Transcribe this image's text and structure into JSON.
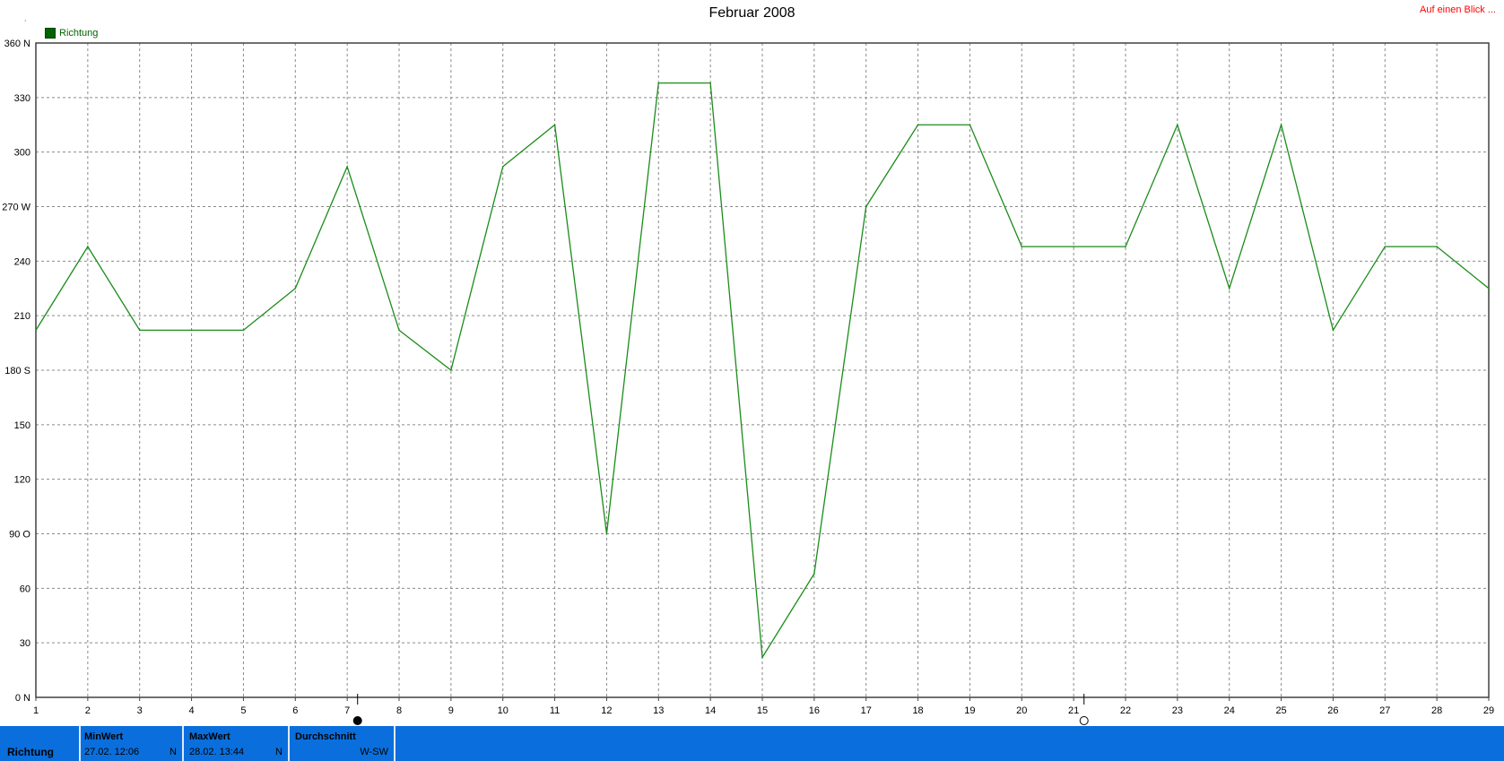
{
  "header": {
    "title": "Februar 2008",
    "link": "Auf einen Blick ...",
    "dot": "˙"
  },
  "legend": {
    "label": "Richtung",
    "color": "#006400"
  },
  "chart_data": {
    "type": "line",
    "title": "Februar 2008",
    "x": [
      1,
      2,
      3,
      4,
      5,
      6,
      7,
      8,
      9,
      10,
      11,
      12,
      13,
      14,
      15,
      16,
      17,
      18,
      19,
      20,
      21,
      22,
      23,
      24,
      25,
      26,
      27,
      28,
      29
    ],
    "series": [
      {
        "name": "Richtung",
        "values": [
          202,
          248,
          202,
          202,
          202,
          225,
          292,
          202,
          180,
          292,
          315,
          90,
          338,
          338,
          22,
          68,
          270,
          315,
          315,
          248,
          248,
          248,
          315,
          225,
          315,
          202,
          248,
          248,
          225
        ]
      }
    ],
    "ylim": [
      0,
      360
    ],
    "yticks": [
      0,
      30,
      60,
      90,
      120,
      150,
      180,
      210,
      240,
      270,
      300,
      330,
      360
    ],
    "ytick_labels": [
      "0",
      "30",
      "60",
      "90",
      "120",
      "150",
      "180",
      "210",
      "240",
      "270",
      "300",
      "330",
      "360"
    ],
    "ytick_directions": {
      "0": "N",
      "90": "O",
      "180": "S",
      "270": "W",
      "360": "N"
    },
    "xticks": [
      "1",
      "2",
      "3",
      "4",
      "5",
      "6",
      "7",
      "8",
      "9",
      "10",
      "11",
      "12",
      "13",
      "14",
      "15",
      "16",
      "17",
      "18",
      "19",
      "20",
      "21",
      "22",
      "23",
      "24",
      "25",
      "26",
      "27",
      "28",
      "29"
    ],
    "grid": true,
    "line_color": "#1a8c1a",
    "moon_phases": [
      {
        "label": "full-moon-icon",
        "x": 7.2
      },
      {
        "label": "new-moon-icon",
        "x": 21.2
      }
    ]
  },
  "stats": {
    "row_label": "Richtung",
    "min": {
      "head": "MinWert",
      "date": "27.02.  12:06",
      "dir": "N"
    },
    "max": {
      "head": "MaxWert",
      "date": "28.02.  13:44",
      "dir": "N"
    },
    "avg": {
      "head": "Durchschnitt",
      "dir": "W-SW"
    }
  },
  "colors": {
    "bar": "#0a6fdc",
    "accent_red": "#ff0000"
  }
}
